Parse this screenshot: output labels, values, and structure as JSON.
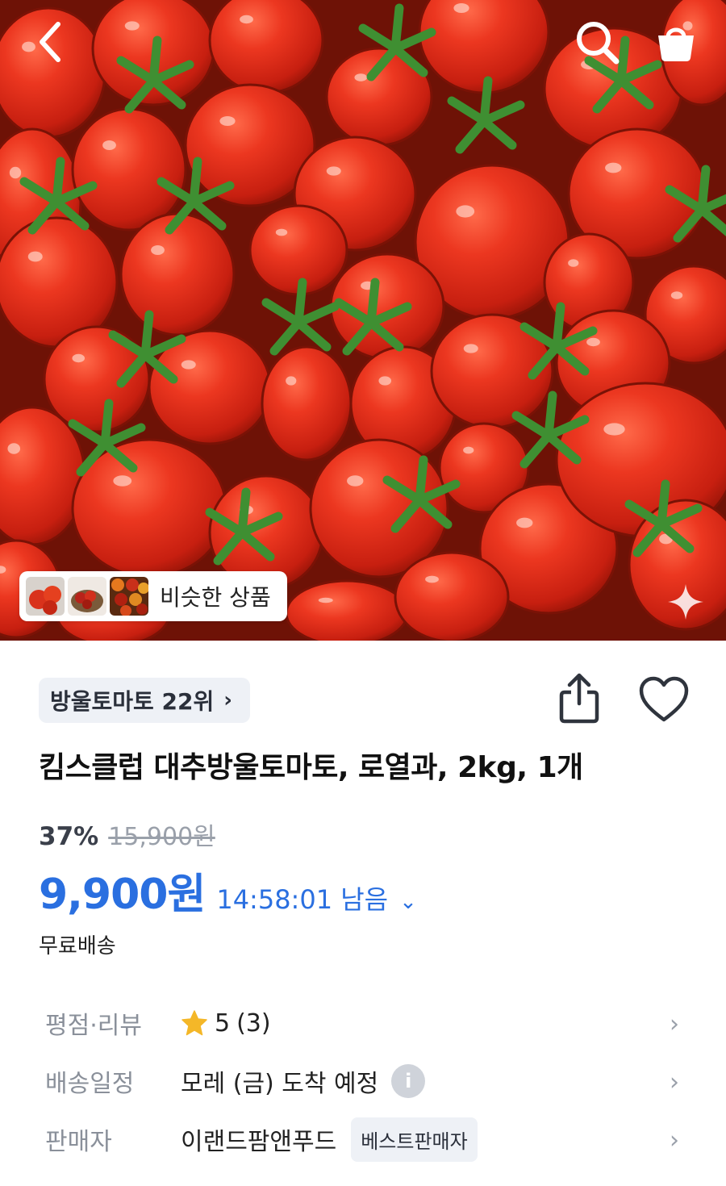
{
  "hero": {
    "similar_label": "비슷한 상품"
  },
  "rank": {
    "label": "방울토마토 22위",
    "chevron": "›"
  },
  "product": {
    "title": "킴스클럽 대추방울토마토, 로열과, 2kg, 1개",
    "discount": "37%",
    "original_price": "15,900원",
    "price": "9,900원",
    "timer": "14:58:01 남음",
    "timer_chevron": "⌄",
    "shipping": "무료배송"
  },
  "info": {
    "rating_key": "평점·리뷰",
    "rating_value": "5",
    "review_count": "(3)",
    "delivery_key": "배송일정",
    "delivery_value": "모레 (금) 도착 예정",
    "info_icon_glyph": "i",
    "seller_key": "판매자",
    "seller_value": "이랜드팜앤푸드",
    "seller_badge": "베스트판매자",
    "chevron": "›"
  },
  "colors": {
    "accent": "#2a6fe0",
    "star": "#f4b728",
    "tomato": "#e5301d",
    "stem": "#3f8f32"
  },
  "icons": [
    "back-icon",
    "search-icon",
    "cart-icon",
    "sparkle-icon",
    "share-icon",
    "heart-icon",
    "star-icon",
    "info-icon",
    "chevron-right-icon"
  ]
}
